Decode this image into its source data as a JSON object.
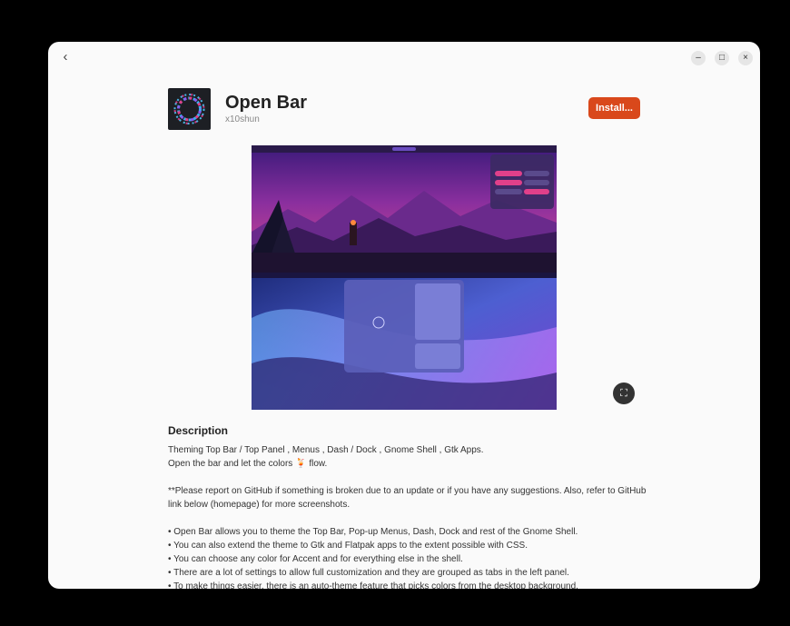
{
  "window": {
    "back_icon": "‹",
    "minimize_icon": "–",
    "maximize_icon": "□",
    "close_icon": "×"
  },
  "app": {
    "name": "Open Bar",
    "developer": "x10shun",
    "install_label": "Install..."
  },
  "description": {
    "heading": "Description",
    "line1": "Theming Top Bar / Top Panel , Menus , Dash / Dock , Gnome Shell , Gtk Apps.",
    "line2": "Open the bar and let the colors 🍹 flow.",
    "line3": "**Please report on GitHub if something is broken due to an update or if you have any suggestions. Also, refer to GitHub link below (homepage) for more screenshots.",
    "bullets": [
      "Open Bar allows you to theme the Top Bar, Pop-up Menus, Dash, Dock and rest of the Gnome Shell.",
      "You can also extend the theme to Gtk and Flatpak apps to the extent possible with CSS.",
      "You can choose any color for Accent and for everything else in the shell.",
      "There are a lot of settings to allow full customization and they are grouped as tabs in the left panel.",
      "To make things easier, there is an auto-theme feature that picks colors from the desktop background."
    ]
  },
  "colors": {
    "install_button": "#d9481b",
    "window_bg": "#fafafa"
  },
  "icons": {
    "fullscreen": "fullscreen-icon"
  }
}
